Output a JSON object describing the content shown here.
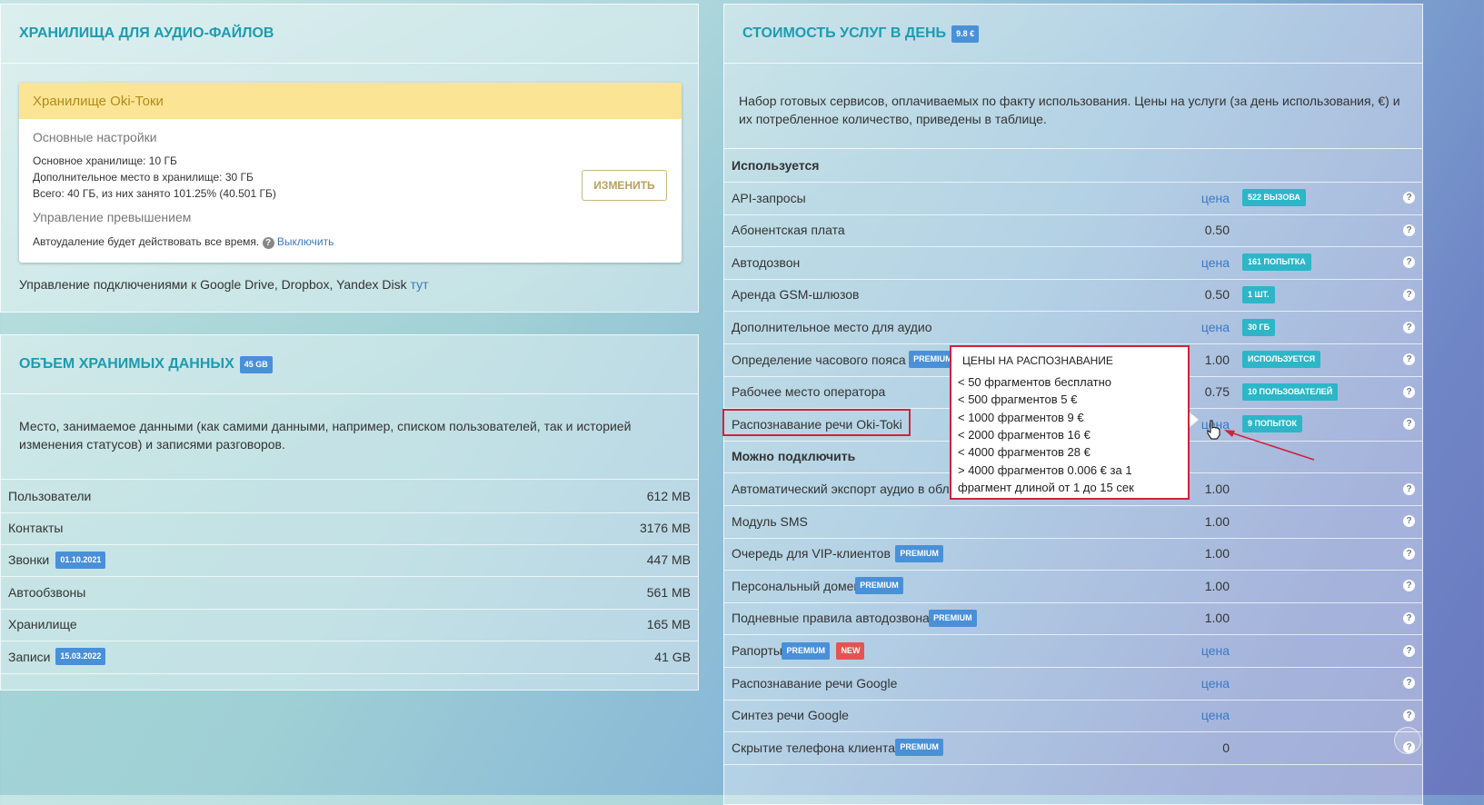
{
  "storage": {
    "title": "ХРАНИЛИЩА ДЛЯ АУДИО-ФАЙЛОВ",
    "card": {
      "header": "Хранилище Oki-Токи",
      "main_settings_label": "Основные настройки",
      "base_storage": "Основное хранилище: 10 ГБ",
      "extra_storage": "Дополнительное место в хранилище: 30 ГБ",
      "total": "Всего: 40 ГБ, из них занято 101.25% (40.501 ГБ)",
      "overflow_label": "Управление превышением",
      "auto_delete": "Автоудаление будет действовать все время.",
      "disable_link": "Выключить",
      "change_button": "ИЗМЕНИТЬ"
    },
    "connections_text": "Управление подключениями к Google Drive, Dropbox, Yandex Disk",
    "connections_link": "тут"
  },
  "volume": {
    "title": "ОБЪЕМ ХРАНИМЫХ ДАННЫХ",
    "badge": "45 GB",
    "description": "Место, занимаемое данными (как самими данными, например, списком пользователей, так и историей изменения статусов) и записями разговоров.",
    "rows": [
      {
        "label": "Пользователи",
        "value": "612 MB",
        "badge": ""
      },
      {
        "label": "Контакты",
        "value": "3176 MB",
        "badge": ""
      },
      {
        "label": "Звонки",
        "value": "447 MB",
        "badge": "01.10.2021"
      },
      {
        "label": "Автообзвоны",
        "value": "561 MB",
        "badge": ""
      },
      {
        "label": "Хранилище",
        "value": "165 MB",
        "badge": ""
      },
      {
        "label": "Записи",
        "value": "41 GB",
        "badge": "15.03.2022"
      }
    ]
  },
  "services": {
    "title": "СТОИМОСТЬ УСЛУГ В ДЕНЬ",
    "badge": "9.8 €",
    "description": "Набор готовых сервисов, оплачиваемых по факту использования. Цены на услуги (за день использования, €) и их потребленное количество, приведены в таблице.",
    "used_header": "Используется",
    "available_header": "Можно подключить",
    "used_rows": [
      {
        "label": "API-запросы",
        "value": "цена",
        "link": true,
        "premium": false,
        "badge": "522 ВЫЗОВА"
      },
      {
        "label": "Абонентская плата",
        "value": "0.50",
        "link": false,
        "premium": false,
        "badge": ""
      },
      {
        "label": "Автодозвон",
        "value": "цена",
        "link": true,
        "premium": false,
        "badge": "161 ПОПЫТКА"
      },
      {
        "label": "Аренда GSM-шлюзов",
        "value": "0.50",
        "link": false,
        "premium": false,
        "badge": "1 ШТ."
      },
      {
        "label": "Дополнительное место для аудио",
        "value": "цена",
        "link": true,
        "premium": false,
        "badge": "30 ГБ"
      },
      {
        "label": "Определение часового пояса",
        "value": "1.00",
        "link": false,
        "premium": true,
        "badge": "ИСПОЛЬЗУЕТСЯ"
      },
      {
        "label": "Рабочее место оператора",
        "value": "0.75",
        "link": false,
        "premium": false,
        "badge": "10 ПОЛЬЗОВАТЕЛЕЙ"
      },
      {
        "label": "Распознавание речи Oki-Toki",
        "value": "цена",
        "link": true,
        "premium": false,
        "badge": "9 ПОПЫТОК"
      }
    ],
    "available_rows": [
      {
        "label": "Автоматический экспорт аудио в обл",
        "value": "1.00",
        "link": false,
        "premium": false,
        "new": false
      },
      {
        "label": "Модуль SMS",
        "value": "1.00",
        "link": false,
        "premium": false,
        "new": false
      },
      {
        "label": "Очередь для VIP-клиентов",
        "value": "1.00",
        "link": false,
        "premium": true,
        "new": false
      },
      {
        "label": "Персональный домен",
        "value": "1.00",
        "link": false,
        "premium": true,
        "new": false
      },
      {
        "label": "Подневные правила автодозвона",
        "value": "1.00",
        "link": false,
        "premium": true,
        "new": false
      },
      {
        "label": "Рапорты",
        "value": "цена",
        "link": true,
        "premium": true,
        "new": true
      },
      {
        "label": "Распознавание речи Google",
        "value": "цена",
        "link": true,
        "premium": false,
        "new": false
      },
      {
        "label": "Синтез речи Google",
        "value": "цена",
        "link": true,
        "premium": false,
        "new": false
      },
      {
        "label": "Скрытие телефона клиента",
        "value": "0",
        "link": false,
        "premium": true,
        "new": false
      }
    ],
    "premium_label": "PREMIUM",
    "new_label": "NEW",
    "help_glyph": "?"
  },
  "tooltip": {
    "title": "ЦЕНЫ НА РАСПОЗНАВАНИЕ",
    "lines": [
      "< 50 фрагментов бесплатно",
      "< 500 фрагментов 5 €",
      "< 1000 фрагментов 9 €",
      "< 2000 фрагментов 16 €",
      "< 4000 фрагментов 28 €",
      "> 4000 фрагментов 0.006 € за 1",
      "фрагмент длиной от 1 до 15 сек"
    ]
  },
  "colors": {
    "accent": "#1e9bb0",
    "link": "#3a79c4",
    "premium_badge": "#4a90d9",
    "count_badge": "#2cb6c8",
    "new_badge": "#e65353",
    "highlight": "#d0223a"
  }
}
